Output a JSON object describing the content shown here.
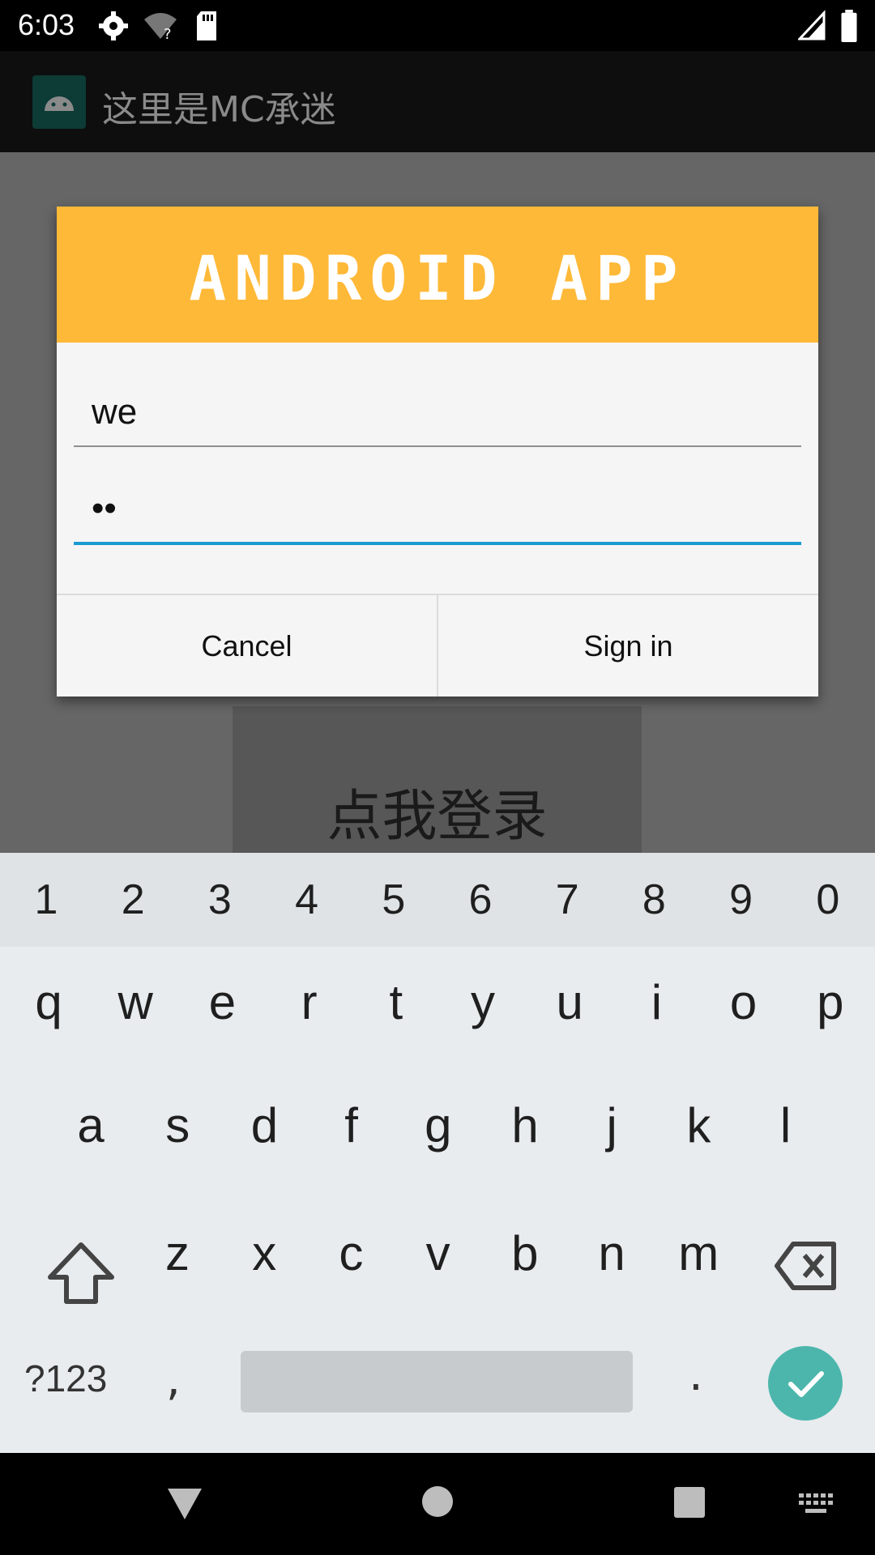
{
  "status_bar": {
    "time": "6:03"
  },
  "app_bar": {
    "title": "这里是MC承迷"
  },
  "background": {
    "login_button_label": "点我登录"
  },
  "dialog": {
    "banner_text": "ANDROID APP",
    "username_value": "we",
    "password_value": "••",
    "cancel_label": "Cancel",
    "signin_label": "Sign in"
  },
  "keyboard": {
    "numbers": [
      "1",
      "2",
      "3",
      "4",
      "5",
      "6",
      "7",
      "8",
      "9",
      "0"
    ],
    "row1": [
      "q",
      "w",
      "e",
      "r",
      "t",
      "y",
      "u",
      "i",
      "o",
      "p"
    ],
    "row2": [
      "a",
      "s",
      "d",
      "f",
      "g",
      "h",
      "j",
      "k",
      "l"
    ],
    "row3": [
      "z",
      "x",
      "c",
      "v",
      "b",
      "n",
      "m"
    ],
    "symbols_label": "?123",
    "comma": ",",
    "period": "."
  },
  "colors": {
    "banner": "#ffb938",
    "accent": "#1a9bd0",
    "enter": "#4db6ac"
  }
}
